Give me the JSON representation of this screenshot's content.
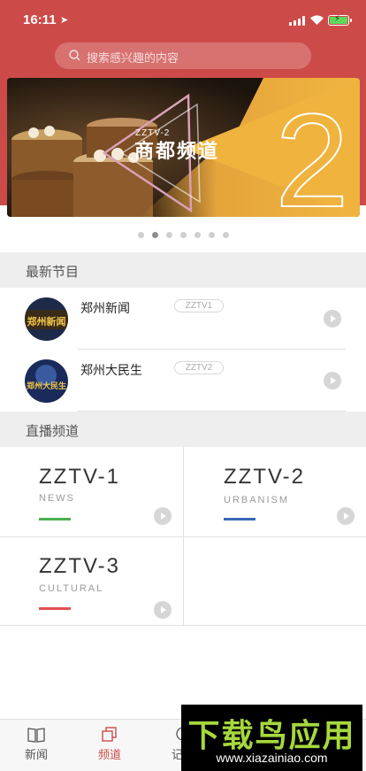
{
  "status_bar": {
    "time": "16:11"
  },
  "search": {
    "placeholder": "搜索感兴趣的内容"
  },
  "banner": {
    "channel_code": "ZZTV-2",
    "channel_name": "商都频道",
    "number": "2"
  },
  "carousel": {
    "count": 7,
    "active_index": 1
  },
  "latest": {
    "title": "最新节目",
    "items": [
      {
        "name": "郑州新闻",
        "tag": "ZZTV1",
        "thumb_text": "郑州新闻"
      },
      {
        "name": "郑州大民生",
        "tag": "ZZTV2",
        "thumb_text": "郑州大民生"
      }
    ]
  },
  "live": {
    "title": "直播频道",
    "channels": [
      {
        "name": "ZZTV-1",
        "sub": "NEWS",
        "color": "#4caf50"
      },
      {
        "name": "ZZTV-2",
        "sub": "URBANISM",
        "color": "#3a67b8"
      },
      {
        "name": "ZZTV-3",
        "sub": "CULTURAL",
        "color": "#e05050"
      }
    ]
  },
  "tabbar": {
    "tabs": [
      {
        "label": "新闻",
        "active": false,
        "color": "#555555"
      },
      {
        "label": "频道",
        "active": true,
        "color": "#cc4b48"
      },
      {
        "label": "记者",
        "active": false,
        "color": "#555555"
      }
    ]
  },
  "watermark": {
    "title": "下载鸟应用",
    "url": "www.xiazainiao.com"
  },
  "colors": {
    "header": "#cc4b48",
    "accent": "#cc4b48"
  }
}
